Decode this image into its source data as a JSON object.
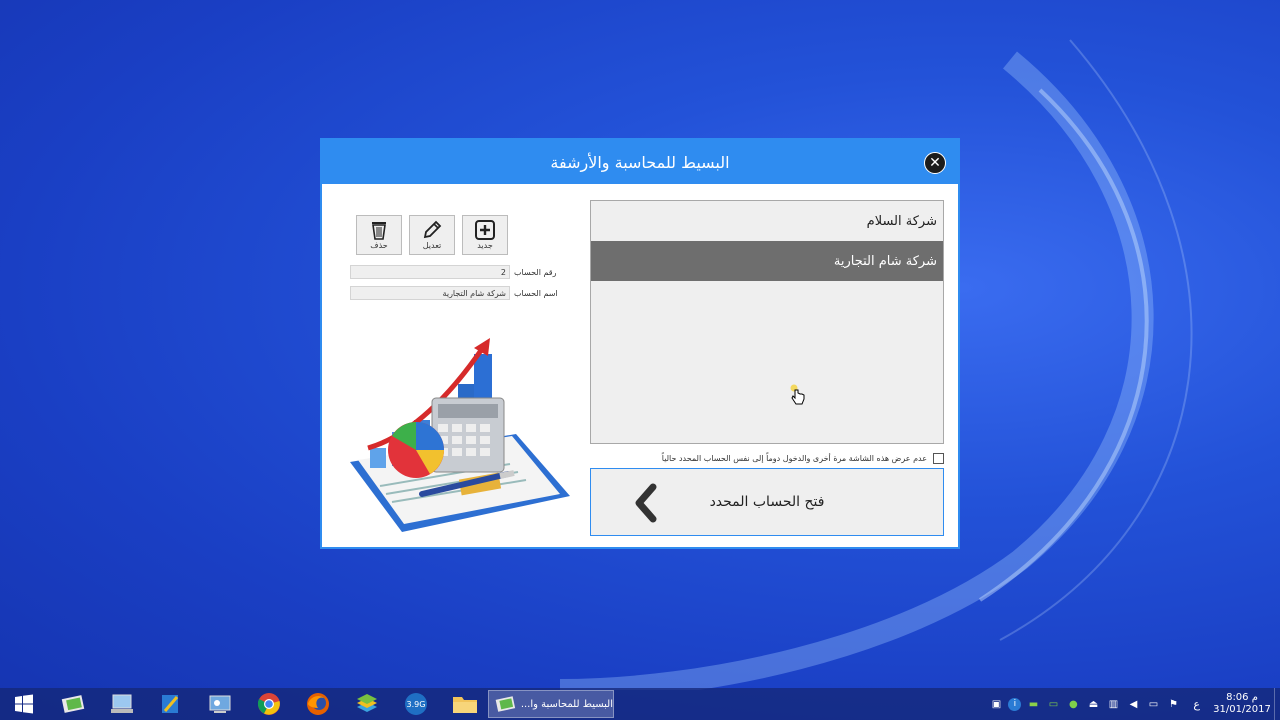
{
  "dialog": {
    "title": "البسيط للمحاسبة والأرشفة",
    "accounts": [
      {
        "name": "شركة السلام",
        "selected": false
      },
      {
        "name": "شركة شام التجارية",
        "selected": true
      }
    ],
    "dont_show_label": "عدم عرض هذه الشاشة مرة أخرى والدخول دوماً إلى نفس الحساب المحدد حالياً",
    "open_button_label": "فتح الحساب المحدد",
    "toolbar": {
      "new_label": "جديد",
      "edit_label": "تعديل",
      "delete_label": "حذف"
    },
    "account_number_label": "رقم الحساب",
    "account_number_value": "2",
    "account_name_label": "اسم الحساب",
    "account_name_value": "شركة شام التجارية"
  },
  "taskbar": {
    "active_task_label": "البسيط للمحاسبة وا...",
    "language": "ع",
    "time": "8:06 م",
    "date": "31/01/2017",
    "icons": [
      "windows-start-icon",
      "app-green-icon",
      "computer-icon",
      "notepad-icon",
      "control-panel-icon",
      "chrome-icon",
      "firefox-icon",
      "bluestacks-icon",
      "xbox-icon",
      "file-explorer-icon"
    ]
  },
  "colors": {
    "accent": "#2f8cf0",
    "selected_row": "#6e6e6e",
    "desktop": "#2352d8"
  }
}
